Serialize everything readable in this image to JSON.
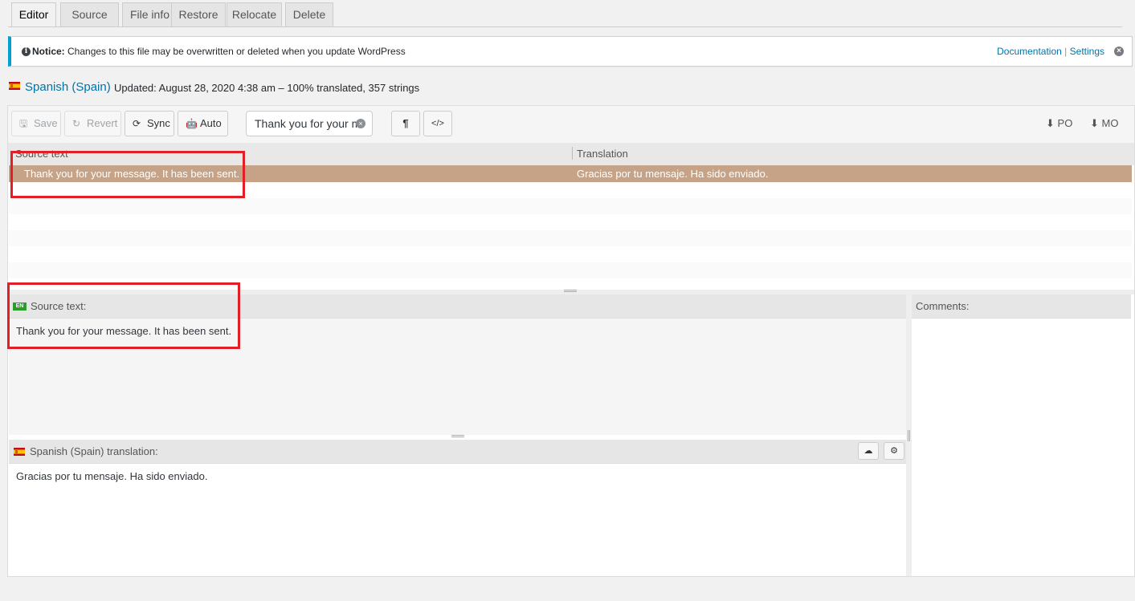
{
  "tabs": [
    {
      "label": "Editor",
      "active": true
    },
    {
      "label": "Source"
    },
    {
      "label": "File info"
    },
    {
      "label": "Restore"
    },
    {
      "label": "Relocate"
    },
    {
      "label": "Delete"
    }
  ],
  "notice": {
    "icon": "info-icon",
    "label": "Notice:",
    "text": "Changes to this file may be overwritten or deleted when you update WordPress",
    "documentation_link": "Documentation",
    "separator": "|",
    "settings_link": "Settings",
    "border_color": "#00a0d2"
  },
  "locale": {
    "name": "Spanish (Spain)",
    "updated": "Updated: August 28, 2020 4:38 am – 100% translated, 357 strings"
  },
  "toolbar": {
    "save_label": "Save",
    "revert_label": "Revert",
    "sync_label": "Sync",
    "auto_label": "Auto",
    "search_value": "Thank you for your message",
    "pilcrow": "¶",
    "code_toggle": "</>",
    "po_label": "PO",
    "mo_label": "MO"
  },
  "table": {
    "columns": [
      "Source text",
      "Translation"
    ],
    "rows": [
      {
        "source": "Thank you for your message. It has been sent.",
        "translation": "Gracias por tu mensaje. Ha sido enviado."
      }
    ],
    "selected_color": "#c6a386"
  },
  "source_pane": {
    "lang_badge": "EN",
    "title": "Source text:",
    "text": "Thank you for your message. It has been sent."
  },
  "translation_pane": {
    "title": "Spanish (Spain) translation:",
    "text": "Gracias por tu mensaje. Ha sido enviado."
  },
  "comments_pane": {
    "title": "Comments:"
  },
  "highlight_color": "#e21f26"
}
